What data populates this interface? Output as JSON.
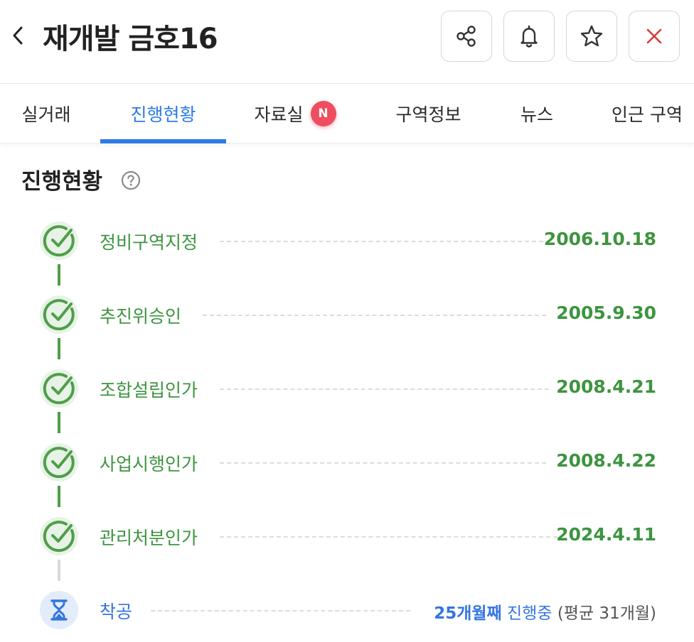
{
  "header": {
    "title": "재개발 금호16",
    "back_icon": "chevron-left-icon",
    "buttons": [
      {
        "name": "share-button",
        "icon": "share-icon"
      },
      {
        "name": "notification-button",
        "icon": "bell-icon"
      },
      {
        "name": "favorite-button",
        "icon": "star-icon"
      },
      {
        "name": "close-button",
        "icon": "close-icon"
      }
    ]
  },
  "tabs": [
    {
      "label": "실거래",
      "active": false
    },
    {
      "label": "진행현황",
      "active": true
    },
    {
      "label": "자료실",
      "active": false,
      "badge": "N"
    },
    {
      "label": "구역정보",
      "active": false
    },
    {
      "label": "뉴스",
      "active": false
    },
    {
      "label": "인근 구역",
      "active": false
    }
  ],
  "section": {
    "title": "진행현황",
    "help_icon": "question-circle-icon"
  },
  "steps": [
    {
      "label": "정비구역지정",
      "date": "2006.10.18",
      "status": "done"
    },
    {
      "label": "추진위승인",
      "date": "2005.9.30",
      "status": "done"
    },
    {
      "label": "조합설립인가",
      "date": "2008.4.21",
      "status": "done"
    },
    {
      "label": "사업시행인가",
      "date": "2008.4.22",
      "status": "done"
    },
    {
      "label": "관리처분인가",
      "date": "2024.4.11",
      "status": "done"
    },
    {
      "label": "착공",
      "status": "pending",
      "progress_months": "25개월째",
      "progress_text": "진행중",
      "average_text": "(평균 31개월)"
    }
  ],
  "colors": {
    "accent_blue": "#2e7be6",
    "done_green": "#3d9440",
    "badge_red": "#ee4e5f",
    "close_red": "#d93a3a"
  }
}
